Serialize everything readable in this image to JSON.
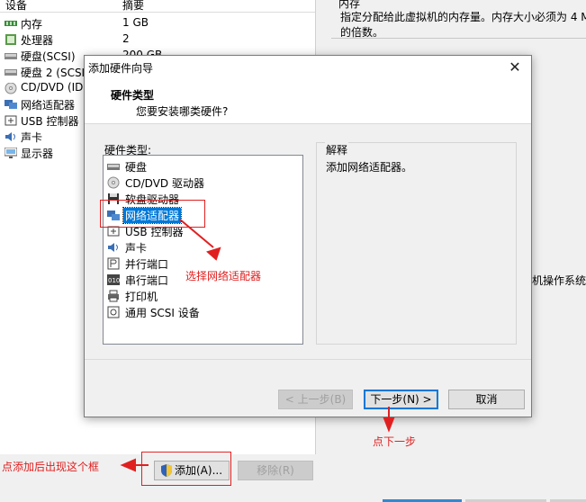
{
  "background": {
    "columns": {
      "device": "设备",
      "summary": "摘要"
    },
    "rows": [
      {
        "name": "内存",
        "value": "1 GB",
        "icon": "memory-icon"
      },
      {
        "name": "处理器",
        "value": "2",
        "icon": "cpu-icon"
      },
      {
        "name": "硬盘(SCSI)",
        "value": "200 GB",
        "icon": "harddisk-icon"
      },
      {
        "name": "硬盘 2 (SCSI",
        "value": "",
        "icon": "harddisk-icon"
      },
      {
        "name": "CD/DVD (IDE",
        "value": "",
        "icon": "cd-icon"
      },
      {
        "name": "网络适配器",
        "value": "",
        "icon": "network-icon"
      },
      {
        "name": "USB 控制器",
        "value": "",
        "icon": "usb-icon"
      },
      {
        "name": "声卡",
        "value": "",
        "icon": "sound-icon"
      },
      {
        "name": "显示器",
        "value": "",
        "icon": "display-icon"
      }
    ],
    "right_title": "内存",
    "right_desc": "指定分配给此虚拟机的内存量。内存大小必须为 4 M 的倍数。",
    "right_text2": "机操作系统",
    "add_button": "添加(A)...",
    "remove_button": "移除(R)"
  },
  "dialog": {
    "title": "添加硬件向导",
    "close": "✕",
    "header_title": "硬件类型",
    "header_subtitle": "您要安装哪类硬件?",
    "list_label": "硬件类型:",
    "items": [
      {
        "label": "硬盘",
        "icon": "harddisk-icon"
      },
      {
        "label": "CD/DVD 驱动器",
        "icon": "cd-icon"
      },
      {
        "label": "软盘驱动器",
        "icon": "floppy-icon"
      },
      {
        "label": "网络适配器",
        "icon": "network-icon"
      },
      {
        "label": "USB 控制器",
        "icon": "usb-icon"
      },
      {
        "label": "声卡",
        "icon": "sound-icon"
      },
      {
        "label": "并行端口",
        "icon": "parallel-port-icon"
      },
      {
        "label": "串行端口",
        "icon": "serial-port-icon"
      },
      {
        "label": "打印机",
        "icon": "printer-icon"
      },
      {
        "label": "通用 SCSI 设备",
        "icon": "scsi-icon"
      }
    ],
    "selected_index": 3,
    "explain_label": "解释",
    "explain_text": "添加网络适配器。",
    "buttons": {
      "back": "< 上一步(B)",
      "next": "下一步(N) >",
      "cancel": "取消"
    }
  },
  "annotations": {
    "select_network": "选择网络适配器",
    "click_next": "点下一步",
    "add_box_note": "点添加后出现这个框"
  },
  "colors": {
    "selection": "#0078d7",
    "annotation": "#e02020"
  }
}
